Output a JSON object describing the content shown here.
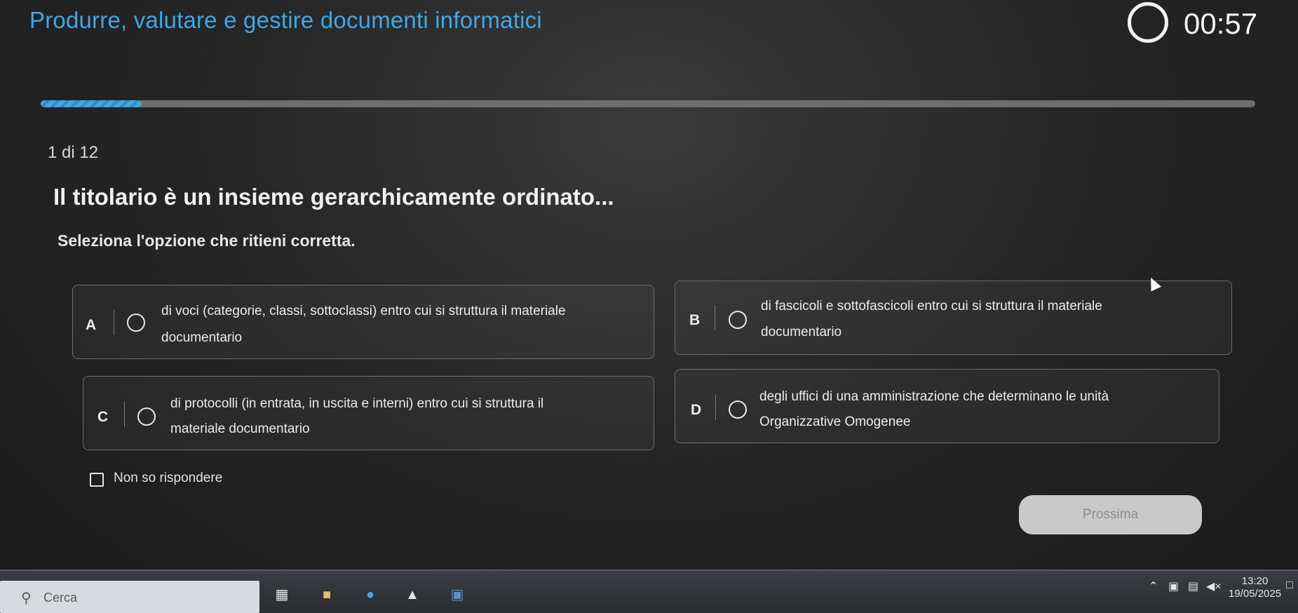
{
  "header": {
    "title": "Produrre, valutare e gestire documenti informatici",
    "timer": "00:57",
    "progress_fraction": 0.083
  },
  "question": {
    "counter": "1 di 12",
    "text": "Il titolario è un insieme gerarchicamente ordinato...",
    "instruction": "Seleziona l'opzione che ritieni corretta."
  },
  "options": [
    {
      "letter": "A",
      "line1": "di voci (categorie, classi, sottoclassi) entro cui si struttura il materiale",
      "line2": "documentario"
    },
    {
      "letter": "B",
      "line1": "di fascicoli e sottofascicoli entro cui si struttura il materiale",
      "line2": "documentario"
    },
    {
      "letter": "C",
      "line1": "di protocolli (in entrata, in uscita e interni) entro cui si struttura il",
      "line2": "materiale documentario"
    },
    {
      "letter": "D",
      "line1": "degli uffici di una amministrazione che determinano le unità",
      "line2": "Organizzative Omogenee"
    }
  ],
  "dont_know_label": "Non so rispondere",
  "next_button": "Prossima",
  "taskbar": {
    "search_placeholder": "Cerca",
    "time": "13:20",
    "date": "19/05/2025",
    "icons": [
      "task-view-icon",
      "folder-icon",
      "edge-icon",
      "app-icon",
      "word-icon"
    ]
  }
}
